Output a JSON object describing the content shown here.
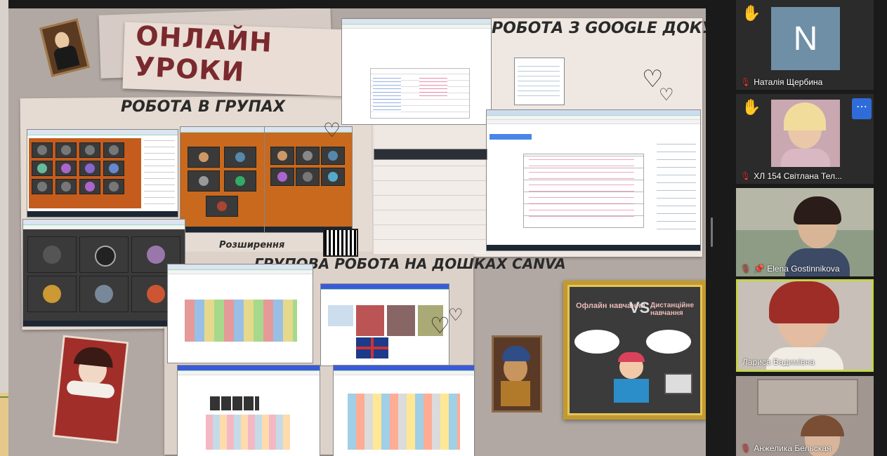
{
  "share": {
    "title": "ОНЛАЙН УРОКИ",
    "labels": {
      "google_docs": "РОБОТА З GOOGLE ДОКУМЕНТАМИ",
      "groups": "РОБОТА В ГРУПАХ",
      "extensions": "Розширення",
      "canva": "ГРУПОВА РОБОТА НА ДОШКАХ CANVA"
    },
    "poster": {
      "left": "Офлайн навчання",
      "vs": "VS",
      "right": "Дистанційне навчання"
    }
  },
  "participants": [
    {
      "name": "Наталія Щербина",
      "muted": true,
      "raised_hand": true,
      "avatar_letter": "N"
    },
    {
      "name": "ХЛ 154 Світлана Тел...",
      "muted": true,
      "raised_hand": true
    },
    {
      "name": "Elena Gostinnikova",
      "muted": true,
      "pinned": true
    },
    {
      "name": "Лариса Вадимівна",
      "muted": false,
      "active_speaker": true
    },
    {
      "name": "Анжелика Бельская",
      "muted": true
    }
  ],
  "colors": {
    "background": "#1a1a1a",
    "share_bg": "#b2a8a3",
    "title_color": "#7a2a2e",
    "active_speaker_border": "#c4d44a",
    "more_button": "#2f6cd9",
    "mic_muted": "#e23b3b"
  },
  "icons": {
    "raise_hand": "raise-hand-icon",
    "mic_muted": "mic-muted-icon",
    "pin": "pin-icon",
    "more": "more-icon"
  }
}
